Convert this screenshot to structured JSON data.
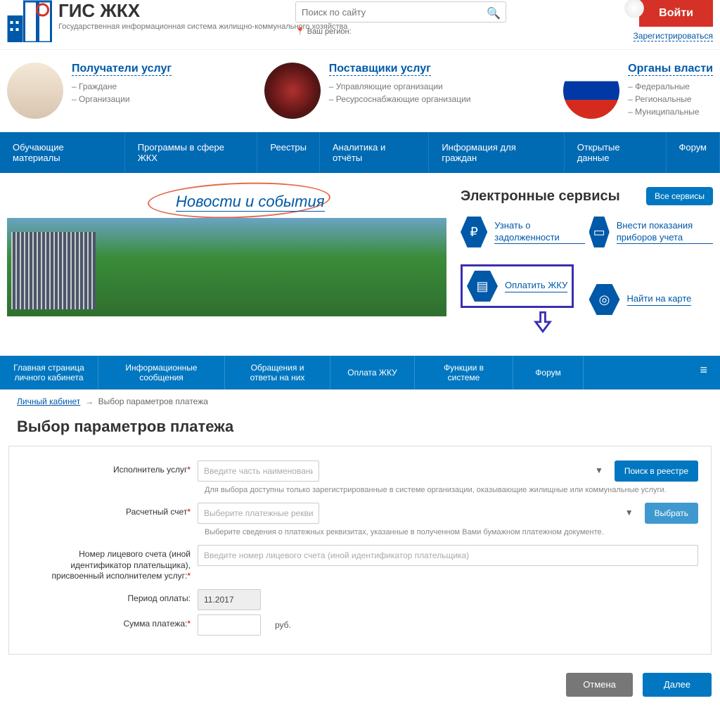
{
  "header": {
    "site_title": "ГИС ЖКХ",
    "site_subtitle": "Государственная информационная система жилищно-коммунального хозяйства",
    "search_placeholder": "Поиск по сайту",
    "region_label": "Ваш регион:",
    "login_label": "Войти",
    "register_label": "Зарегистрироваться"
  },
  "roles": [
    {
      "title": "Получатели услуг",
      "items": [
        "– Граждане",
        "– Организации"
      ]
    },
    {
      "title": "Поставщики услуг",
      "items": [
        "– Управляющие организации",
        "– Ресурсоснабжающие организации"
      ]
    },
    {
      "title": "Органы власти",
      "items": [
        "– Федеральные",
        "– Региональные",
        "– Муниципальные"
      ]
    }
  ],
  "main_nav": [
    "Обучающие материалы",
    "Программы в сфере ЖКХ",
    "Реестры",
    "Аналитика и отчёты",
    "Информация для граждан",
    "Открытые данные",
    "Форум"
  ],
  "news_heading": "Новости и события",
  "services": {
    "heading": "Электронные сервисы",
    "all_btn": "Все сервисы",
    "items": [
      {
        "icon": "₽",
        "label": "Узнать о задолженности"
      },
      {
        "icon": "▭",
        "label": "Внести показания приборов учета"
      },
      {
        "icon": "▤",
        "label": "Оплатить ЖКУ"
      },
      {
        "icon": "◎",
        "label": "Найти на карте"
      }
    ]
  },
  "sub_nav": [
    "Главная страница личного кабинета",
    "Информационные сообщения",
    "Обращения и ответы на них",
    "Оплата ЖКУ",
    "Функции в системе",
    "Форум"
  ],
  "breadcrumb": {
    "root": "Личный кабинет",
    "sep": "→",
    "current": "Выбор параметров платежа"
  },
  "page_title": "Выбор параметров платежа",
  "form": {
    "provider_label": "Исполнитель услуг",
    "provider_placeholder": "Введите часть наименования организации, ОГРН, КПП, ИНН, ФИО, ОГРНИП",
    "provider_hint": "Для выбора доступны только зарегистрированные в системе организации, оказывающие жилищные или коммунальные услуги.",
    "search_reg_btn": "Поиск в реестре",
    "account_label": "Расчетный счет",
    "account_placeholder": "Выберите платежные реквизиты исполнителя услуг",
    "account_hint": "Выберите сведения о платежных реквизитах, указанные в полученном Вами бумажном платежном документе.",
    "select_btn": "Выбрать",
    "ls_label": "Номер лицевого счета (иной идентификатор плательщика), присвоенный исполнителем услуг:",
    "ls_placeholder": "Введите номер лицевого счета (иной идентификатор плательщика)",
    "period_label": "Период оплаты:",
    "period_value": "11.2017",
    "sum_label": "Сумма платежа:",
    "sum_unit": "руб."
  },
  "actions": {
    "cancel": "Отмена",
    "next": "Далее"
  }
}
